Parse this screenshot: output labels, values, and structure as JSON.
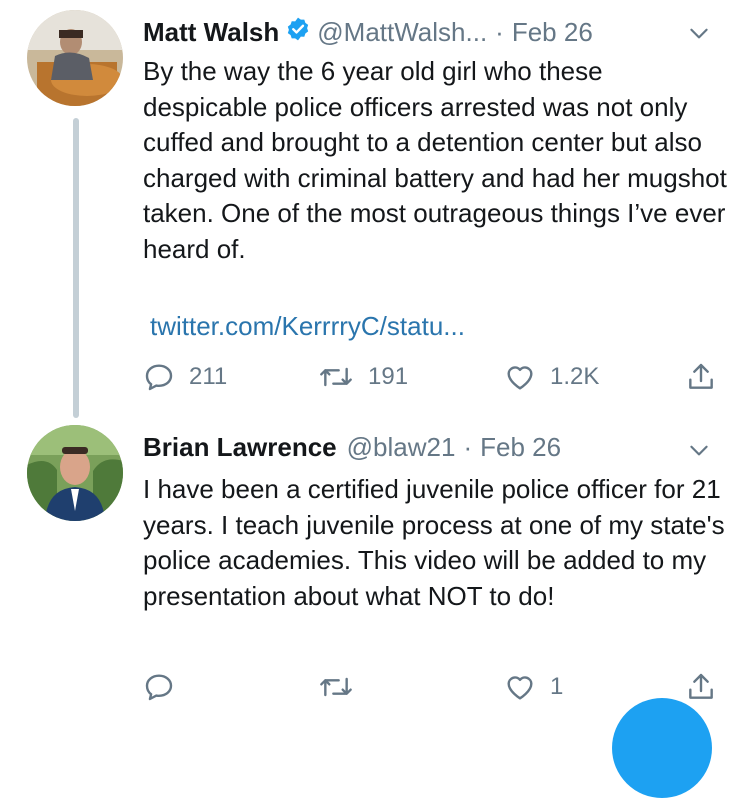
{
  "tweets": [
    {
      "name": "Matt Walsh",
      "handle": "@MattWalsh...",
      "separator": "·",
      "date": "Feb 26",
      "verified": true,
      "text": "By the way the 6 year old girl who these despicable police officers arrested was not only cuffed and brought to a detention center but also charged with criminal battery and had her mugshot taken. One of the most outrageous things I’ve ever heard of.",
      "link": "twitter.com/KerrrryC/statu...",
      "replies": "211",
      "retweets": "191",
      "likes": "1.2K"
    },
    {
      "name": "Brian Lawrence",
      "handle": "@blaw21",
      "separator": "·",
      "date": "Feb 26",
      "verified": false,
      "text": "I have been a certified juvenile police officer for 21 years. I teach juvenile process at one of my state's police academies. This video will be added to my presentation about what NOT to do!",
      "replies": "",
      "retweets": "",
      "likes": "1"
    }
  ],
  "colors": {
    "accent": "#1da1f2",
    "link": "#2a75ad",
    "muted": "#657786",
    "thread_line": "#c4cfd6"
  },
  "icons": [
    "reply-icon",
    "retweet-icon",
    "like-icon",
    "share-icon",
    "chevron-down-icon",
    "verified-badge-icon"
  ]
}
